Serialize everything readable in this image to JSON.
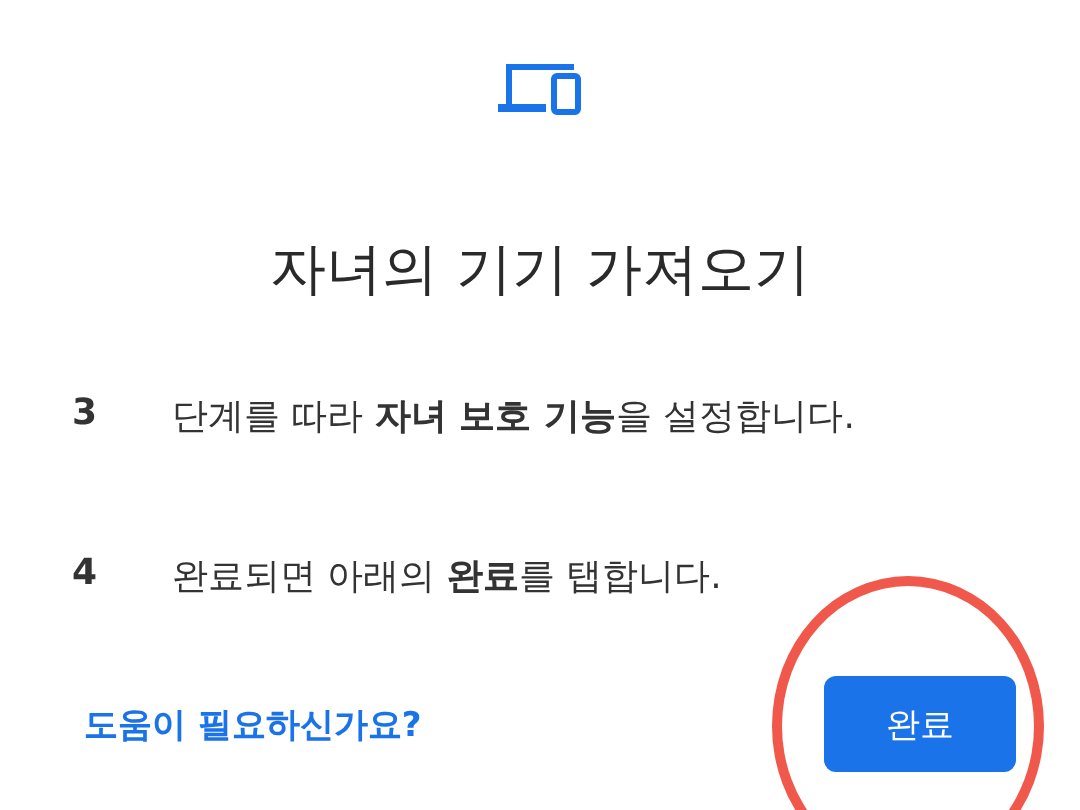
{
  "title": "자녀의 기기 가져오기",
  "steps": [
    {
      "number": "3",
      "text": "단계를 따라 **자녀 보호 기능**을 설정합니다."
    },
    {
      "number": "4",
      "text": "완료되면 아래의 **완료**를 탭합니다."
    }
  ],
  "help_link": "도움이 필요하신가요?",
  "done_button": {
    "label": "완료",
    "highlighted": true
  }
}
